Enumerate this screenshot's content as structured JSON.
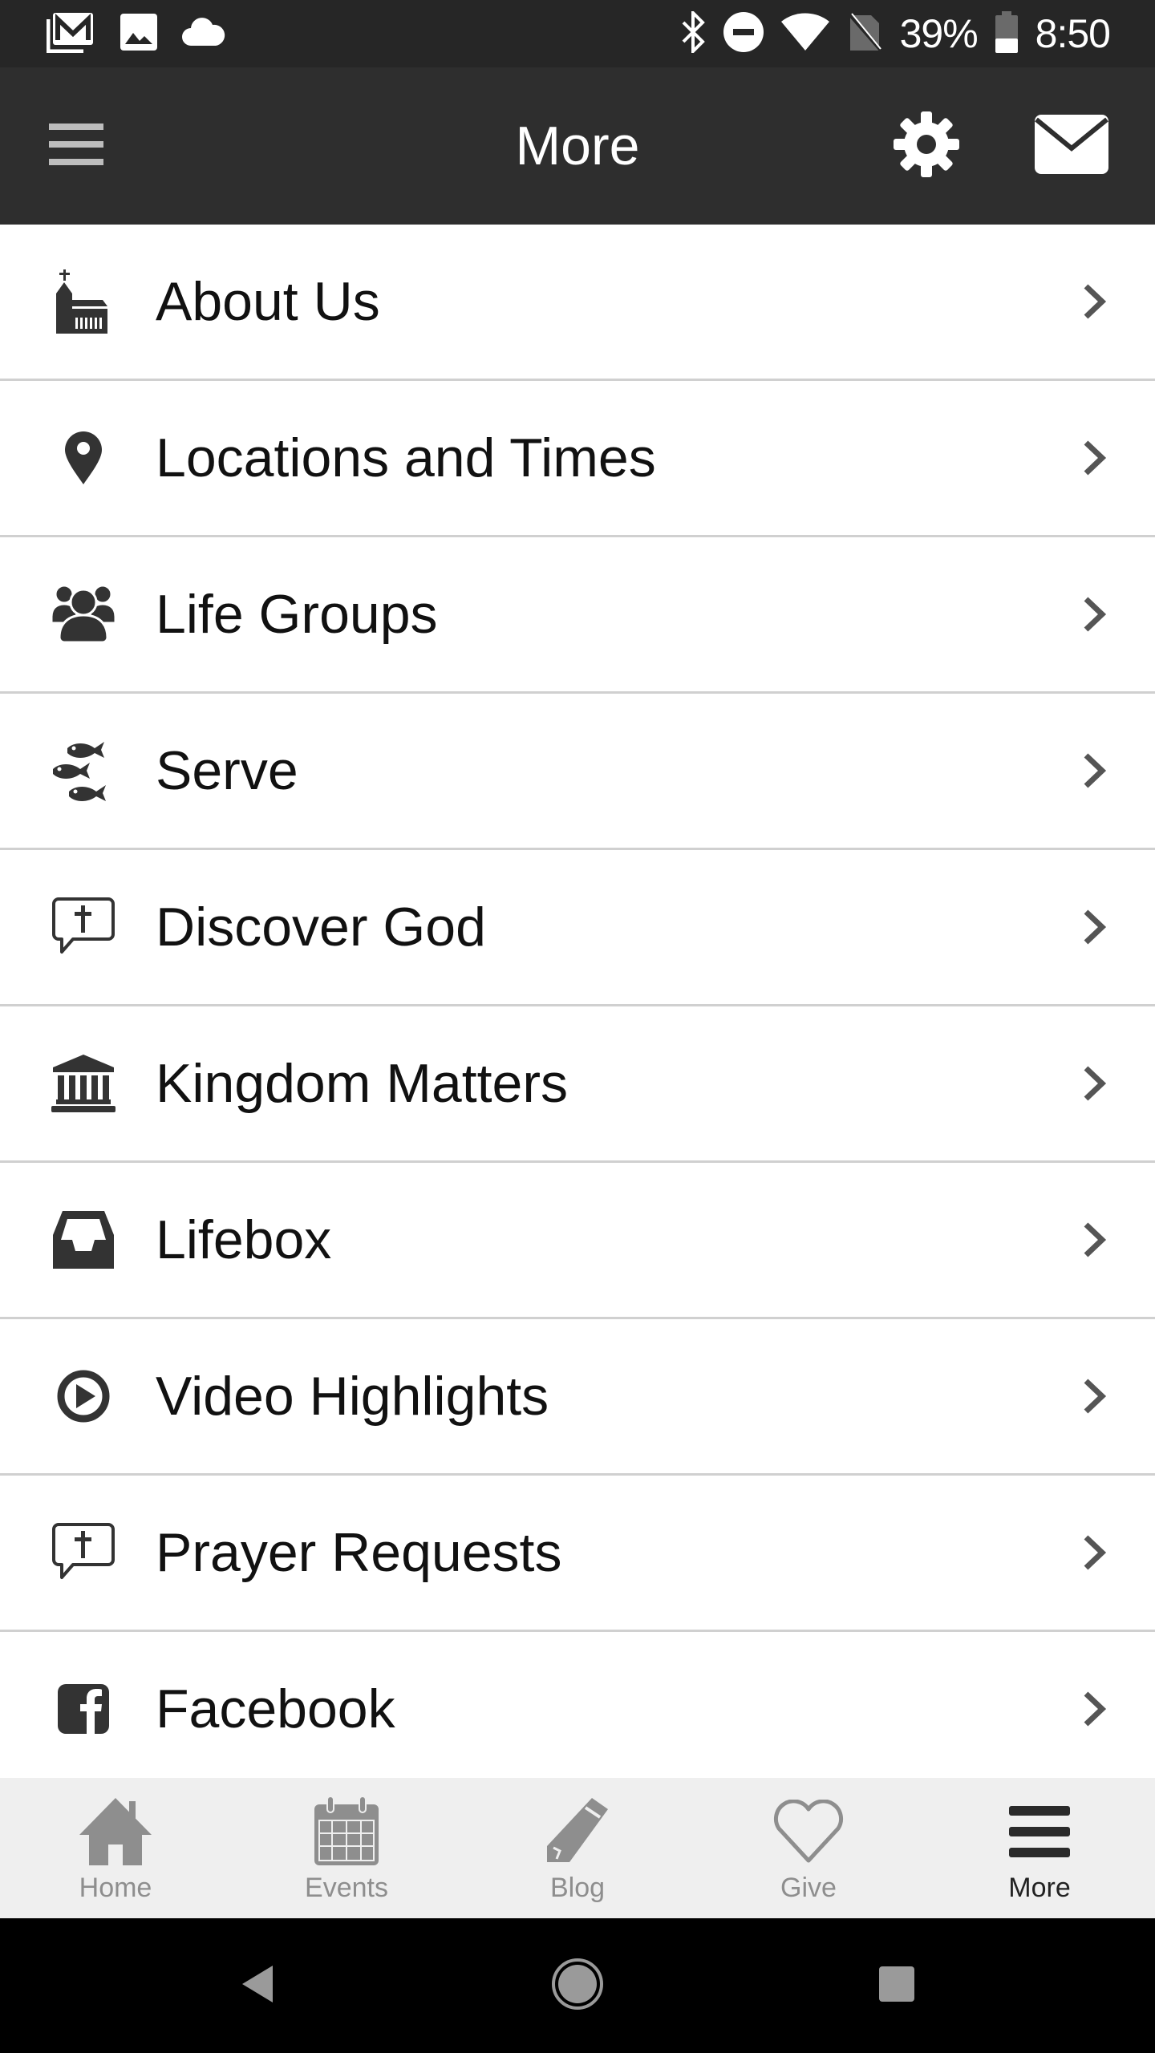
{
  "status_bar": {
    "left_icons": [
      "gmail-icon",
      "image-icon",
      "cloud-icon"
    ],
    "right_icons": [
      "bluetooth-icon",
      "do-not-disturb-icon",
      "wifi-icon",
      "no-sim-icon"
    ],
    "battery_percent": "39%",
    "battery_level": 0.39,
    "time": "8:50"
  },
  "header": {
    "title": "More",
    "left_icon": "hamburger-menu-icon",
    "right_icons": [
      "settings-gear-icon",
      "mail-envelope-icon"
    ]
  },
  "menu": {
    "items": [
      {
        "label": "About Us",
        "icon": "church-icon"
      },
      {
        "label": "Locations and Times",
        "icon": "map-pin-icon"
      },
      {
        "label": "Life Groups",
        "icon": "group-people-icon"
      },
      {
        "label": "Serve",
        "icon": "fish-icon"
      },
      {
        "label": "Discover God",
        "icon": "speech-cross-icon"
      },
      {
        "label": "Kingdom Matters",
        "icon": "bank-institution-icon"
      },
      {
        "label": "Lifebox",
        "icon": "inbox-tray-icon"
      },
      {
        "label": "Video Highlights",
        "icon": "play-circle-icon"
      },
      {
        "label": "Prayer Requests",
        "icon": "speech-cross-icon"
      },
      {
        "label": "Facebook",
        "icon": "facebook-icon"
      }
    ],
    "chevron_icon": "chevron-right-icon"
  },
  "tab_bar": {
    "tabs": [
      {
        "label": "Home",
        "icon": "home-icon",
        "active": false
      },
      {
        "label": "Events",
        "icon": "calendar-icon",
        "active": false
      },
      {
        "label": "Blog",
        "icon": "pencil-icon",
        "active": false
      },
      {
        "label": "Give",
        "icon": "heart-icon",
        "active": false
      },
      {
        "label": "More",
        "icon": "hamburger-menu-icon",
        "active": true
      }
    ]
  },
  "nav_bar": {
    "buttons": [
      "back-icon",
      "home-circle-icon",
      "recents-square-icon"
    ]
  },
  "colors": {
    "status_bar_bg": "#262626",
    "header_bg": "#2e2e2e",
    "icon_dark": "#333333",
    "chevron": "#555555",
    "divider": "#d0d0d0",
    "tab_bar_bg": "#efefef",
    "tab_inactive": "#8e8e8e",
    "tab_active": "#222222"
  }
}
